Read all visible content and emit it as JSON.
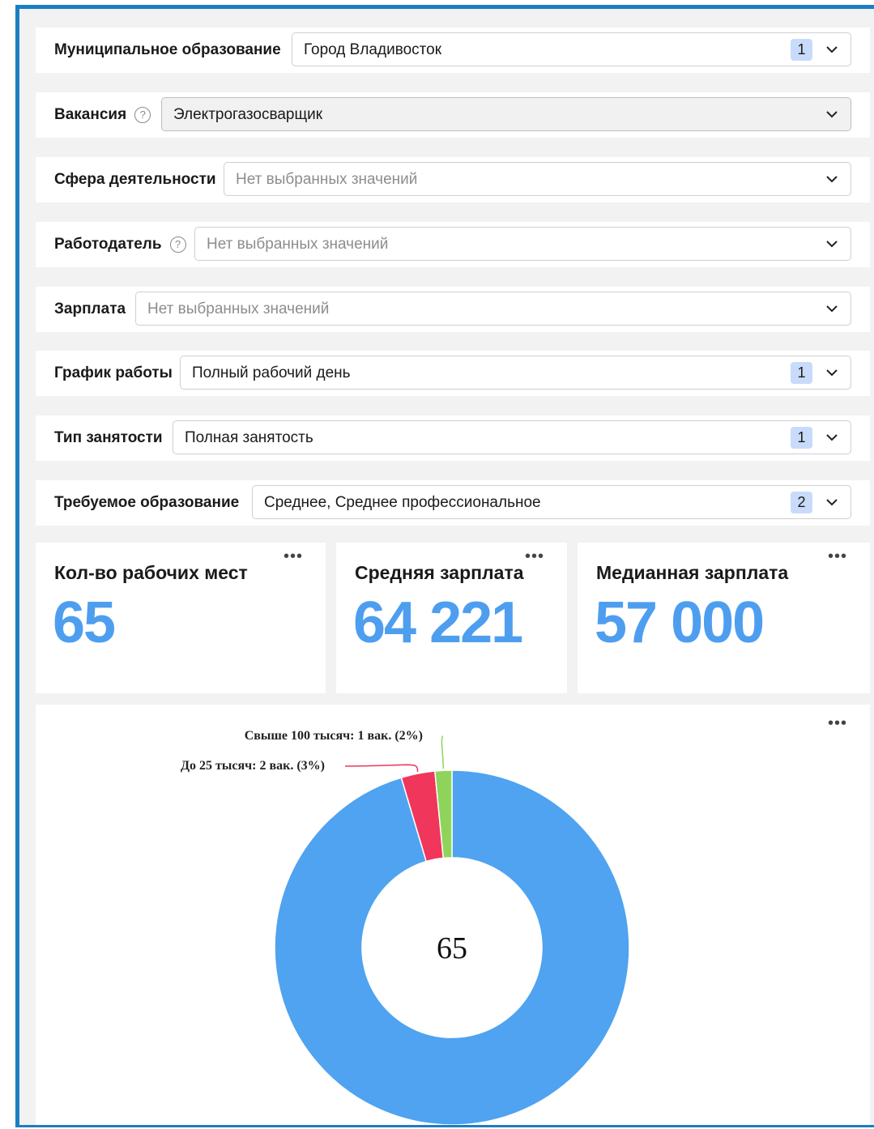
{
  "filters": [
    {
      "label": "Муниципальное образование",
      "value": "Город Владивосток",
      "count": "1",
      "help": false,
      "placeholder": false
    },
    {
      "label": "Вакансия",
      "value": "Электрогазосварщик",
      "count": "",
      "help": true,
      "placeholder": false
    },
    {
      "label": "Сфера деятельности",
      "value": "Нет выбранных значений",
      "count": "",
      "help": false,
      "placeholder": true
    },
    {
      "label": "Работодатель",
      "value": "Нет выбранных значений",
      "count": "",
      "help": true,
      "placeholder": true
    },
    {
      "label": "Зарплата",
      "value": "Нет выбранных значений",
      "count": "",
      "help": false,
      "placeholder": true
    },
    {
      "label": "График работы",
      "value": "Полный рабочий день",
      "count": "1",
      "help": false,
      "placeholder": false
    },
    {
      "label": "Тип занятости",
      "value": "Полная занятость",
      "count": "1",
      "help": false,
      "placeholder": false
    },
    {
      "label": "Требуемое образование",
      "value": "Среднее, Среднее профессиональное",
      "count": "2",
      "help": false,
      "placeholder": false
    }
  ],
  "help_glyph": "?",
  "more_glyph": "•••",
  "kpis": [
    {
      "title": "Кол-во рабочих мест",
      "value": "65"
    },
    {
      "title": "Средняя зарплата",
      "value": "64 221"
    },
    {
      "title": "Медианная зарплата",
      "value": "57 000"
    }
  ],
  "chart_data": {
    "type": "pie",
    "variant": "donut",
    "center_label": "65",
    "slices": [
      {
        "label": "",
        "value": 62,
        "color": "#4fa3f0"
      },
      {
        "label": "До 25 тысяч: 2 вак. (3%)",
        "value": 2,
        "color": "#f0365a"
      },
      {
        "label": "Свыше 100 тысяч: 1 вак. (2%)",
        "value": 1,
        "color": "#8ed45a"
      }
    ]
  },
  "colors": {
    "accent": "#4e9ef0",
    "frame": "#1a7fc1",
    "badge": "#c8dbfb"
  }
}
